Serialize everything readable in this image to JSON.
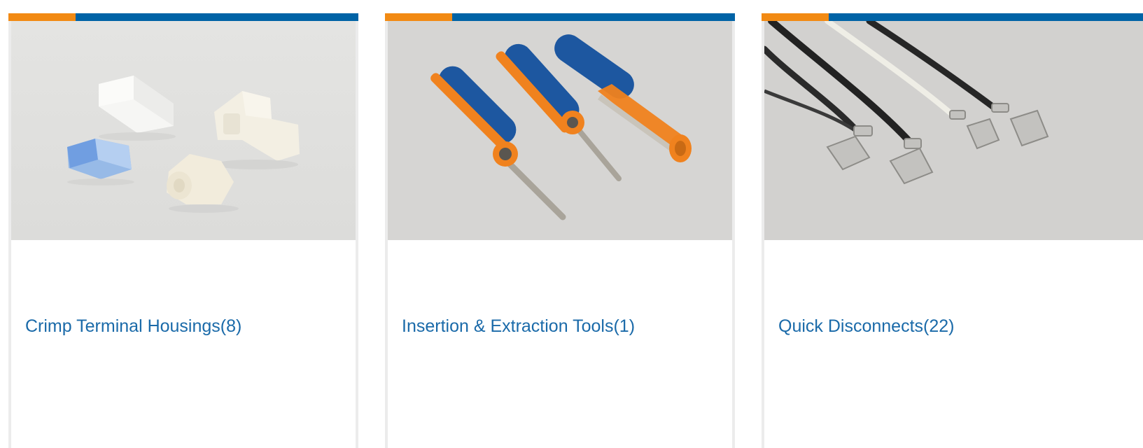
{
  "colors": {
    "accent_orange": "#f28a13",
    "accent_blue": "#0063a6",
    "link_text": "#1a6aa9",
    "card_border": "#ececec"
  },
  "categories": [
    {
      "name": "Crimp Terminal Housings",
      "count": "(8)",
      "label": "Crimp Terminal Housings(8)",
      "image": "crimp-terminal-housings-photo"
    },
    {
      "name": "Insertion & Extraction Tools",
      "count": "(1)",
      "label": "Insertion & Extraction Tools(1)",
      "image": "insertion-extraction-tools-photo"
    },
    {
      "name": "Quick Disconnects",
      "count": "(22)",
      "label": "Quick Disconnects(22)",
      "image": "quick-disconnects-photo"
    }
  ]
}
